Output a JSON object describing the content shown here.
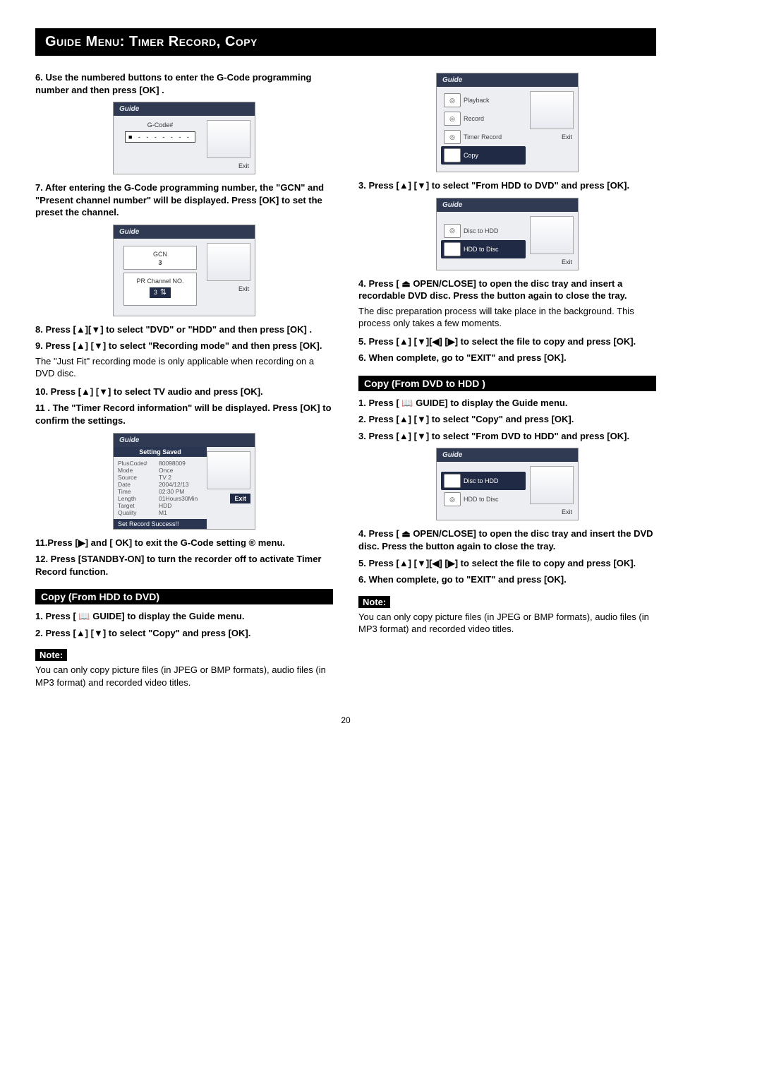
{
  "title": "Guide Menu: Timer Record, Copy",
  "left": {
    "s6": "6.  Use the numbered buttons to enter the G-Code programming number and then press [OK] .",
    "g1": {
      "head": "Guide",
      "label": "G-Code#",
      "input": "■ - - - - - - -",
      "exit": "Exit"
    },
    "s7": "7.  After entering the G-Code programming number, the \"GCN\" and \"Present channel number\" will be displayed.  Press [OK] to set the preset the channel.",
    "g2": {
      "head": "Guide",
      "gcn_label": "GCN",
      "gcn_val": "3",
      "pr_label": "PR Channel NO.",
      "pr_val": "3",
      "exit": "Exit"
    },
    "s8": "8.   Press [▲][▼] to select \"DVD\" or \"HDD\" and then press [OK] .",
    "s9": "9.   Press [▲]  [▼] to select \"Recording mode\" and then press [OK].",
    "s9note": "The \"Just Fit\" recording mode is only applicable when recording on a DVD disc.",
    "s10": "10. Press [▲]  [▼] to select TV audio and press [OK].",
    "s11a": "11 . The \"Timer Record information\" will be displayed. Press [OK] to confirm the settings.",
    "g3": {
      "head": "Guide",
      "title": "Setting Saved",
      "rows": [
        [
          "PlusCode#",
          "80098009"
        ],
        [
          "Mode",
          "Once"
        ],
        [
          "Source",
          "TV   2"
        ],
        [
          "Date",
          "2004/12/13"
        ],
        [
          "Time",
          "02:30 PM"
        ],
        [
          "Length",
          "01Hours30Min"
        ],
        [
          "Target",
          "HDD"
        ],
        [
          "Quality",
          "M1"
        ]
      ],
      "foot": "Set Record Success!!",
      "exit": "Exit"
    },
    "s11b": "11.Press [▶]  and [ OK] to exit the G-Code setting ® menu.",
    "s12": "12. Press [STANDBY-ON] to turn the recorder off to activate Timer Record function.",
    "sec1": "Copy (From HDD to DVD)",
    "h1": "1.  Press [ 📖 GUIDE] to display the Guide menu.",
    "h2": "2.  Press [▲]  [▼] to select \"Copy\" and press [OK].",
    "note": "Note:",
    "noteText": "You can only copy picture files (in JPEG or BMP formats), audio files (in MP3 format) and recorded video titles."
  },
  "right": {
    "g4": {
      "head": "Guide",
      "items": [
        "Playback",
        "Record",
        "Timer Record",
        "Copy"
      ],
      "selected": 3,
      "exit": "Exit"
    },
    "r3": "3.  Press  [▲]  [▼] to select \"From HDD to DVD\" and press [OK].",
    "g5": {
      "head": "Guide",
      "items": [
        "Disc to HDD",
        "HDD to Disc"
      ],
      "selected": 1,
      "exit": "Exit"
    },
    "r4": "4.  Press [ ⏏ OPEN/CLOSE] to open the disc tray and insert a recordable DVD disc. Press the button again to close the tray.",
    "r4note": "The disc preparation process will take place in the background. This process only takes a few moments.",
    "r5": "5. Press [▲] [▼][◀] [▶] to select the file to copy and press [OK].",
    "r6": "6. When complete, go to \"EXIT\" and press [OK].",
    "sec2": "Copy (From DVD to HDD )",
    "d1": "1.  Press [ 📖 GUIDE] to display the Guide menu.",
    "d2": "2.  Press [▲]  [▼] to select \"Copy\" and press [OK].",
    "d3": "3.  Press  [▲]  [▼] to select \"From DVD to HDD\" and press [OK].",
    "g6": {
      "head": "Guide",
      "items": [
        "Disc to HDD",
        "HDD to Disc"
      ],
      "selected": 0,
      "exit": "Exit"
    },
    "d4": "4.  Press [ ⏏ OPEN/CLOSE] to open the disc tray and insert the DVD disc. Press the button again to close the tray.",
    "d5": "5. Press [▲] [▼][◀] [▶] to select the file to copy and press [OK].",
    "d6": "6. When complete, go to \"EXIT\" and press [OK].",
    "note": "Note:",
    "noteText": "You can only copy picture files (in JPEG or BMP formats), audio files (in MP3 format) and recorded video titles."
  },
  "page": "20"
}
